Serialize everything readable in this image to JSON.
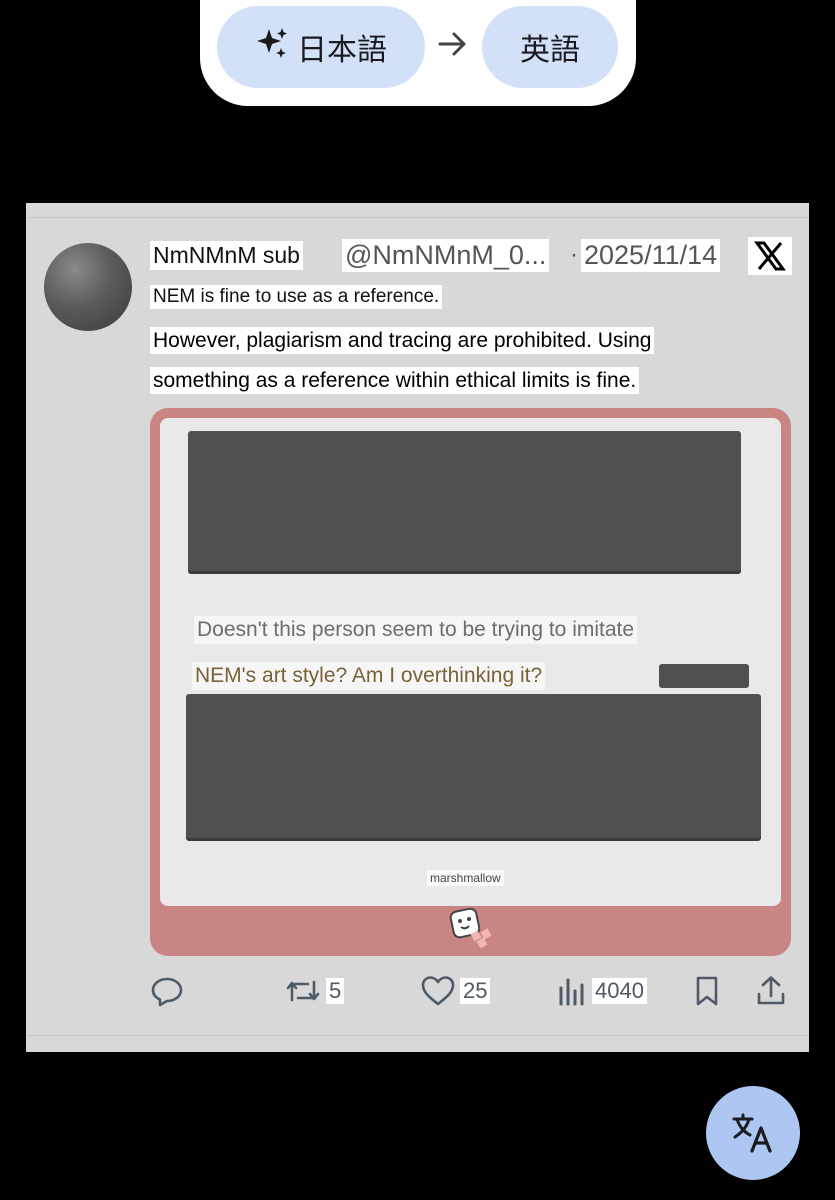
{
  "language_bar": {
    "source_language": "日本語",
    "target_language": "英語"
  },
  "post": {
    "display_name": "NmNMnM sub",
    "handle": "@NmNMnM_0...",
    "date": "2025/11/14",
    "separator": "·",
    "text_line1": "NEM is fine to use as a reference.",
    "text_line2a": "However, plagiarism and tracing are prohibited. Using",
    "text_line2b": "something as a reference within ethical limits is fine.",
    "embedded_image": {
      "question_line1": "Doesn't this person seem to be trying to imitate",
      "question_line2": "NEM's art style? Am I overthinking it?",
      "service_label": "marshmallow"
    },
    "metrics": {
      "reposts": "5",
      "likes": "25",
      "views": "4040"
    }
  },
  "icons": [
    "sparkle-icon",
    "arrow-right-icon",
    "x-logo-icon",
    "reply-icon",
    "repost-icon",
    "like-icon",
    "views-icon",
    "bookmark-icon",
    "share-icon",
    "marshmallow-logo-icon",
    "translate-icon"
  ],
  "colors": {
    "pill": "#d3e1f8",
    "card_bg": "#d8d8d8",
    "marshmallow_frame": "#c98583",
    "fab": "#aec6f2"
  }
}
